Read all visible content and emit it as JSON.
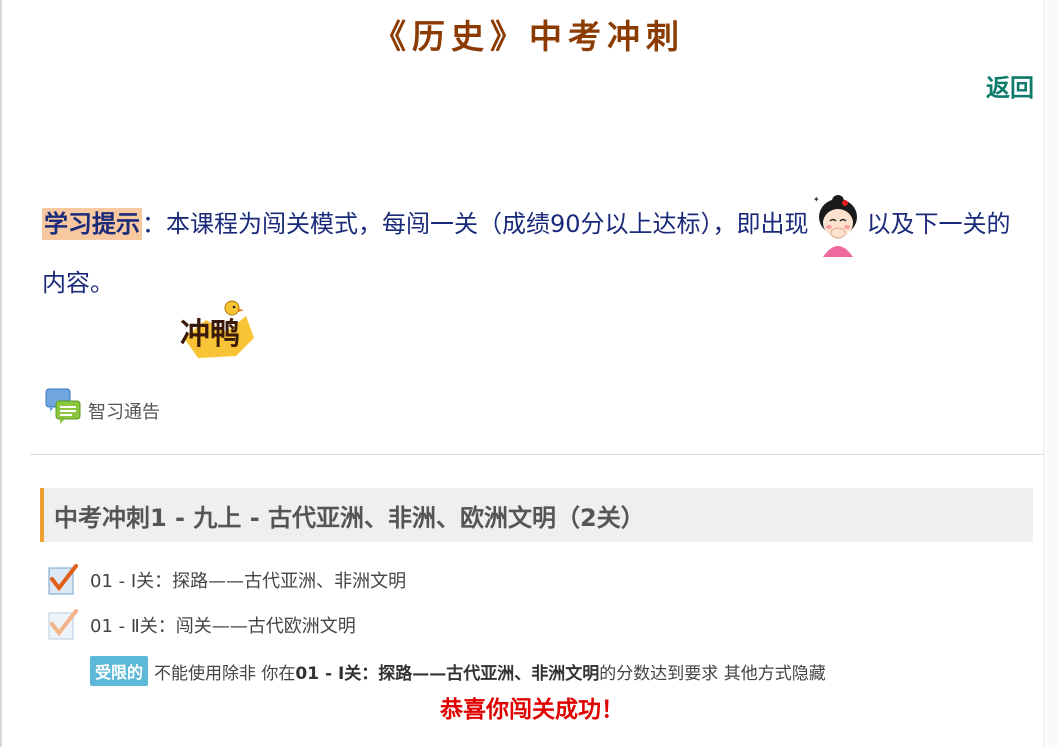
{
  "page": {
    "title": "《历史》中考冲刺",
    "back_label": "返回"
  },
  "tip": {
    "label": "学习提示",
    "text_before": "：本课程为闯关模式，每闯一关（成绩90分以上达标），即出现",
    "text_after": "以及下一关的内容。"
  },
  "stickers": {
    "girl_icon": "girl-cheering-icon",
    "duck_icon": "duck-sticker-icon",
    "duck_text": "冲鸭"
  },
  "forum": {
    "label": "智习通告",
    "icon": "chat-bubbles-icon"
  },
  "section": {
    "title": "中考冲刺1 - 九上 - 古代亚洲、非洲、欧洲文明（2关）"
  },
  "lessons": [
    {
      "text": "01 - Ⅰ关：探路——古代亚洲、非洲文明",
      "status": "completed"
    },
    {
      "text": "01 - Ⅱ关：闯关——古代欧洲文明",
      "status": "locked"
    }
  ],
  "restriction": {
    "badge": "受限的",
    "prefix": "不能使用除非 你在",
    "target": "01 - Ⅰ关：探路——古代亚洲、非洲文明",
    "suffix": "的分数达到要求 其他方式隐藏"
  },
  "congrats": "恭喜你闯关成功！",
  "colors": {
    "title": "#8b3a00",
    "back": "#0d7a6b",
    "tip_text": "#1a2a7a",
    "tip_label_bg": "#f8c9a0",
    "section_accent": "#f0a030",
    "badge": "#5bb8d6",
    "congrats": "#e00000"
  }
}
